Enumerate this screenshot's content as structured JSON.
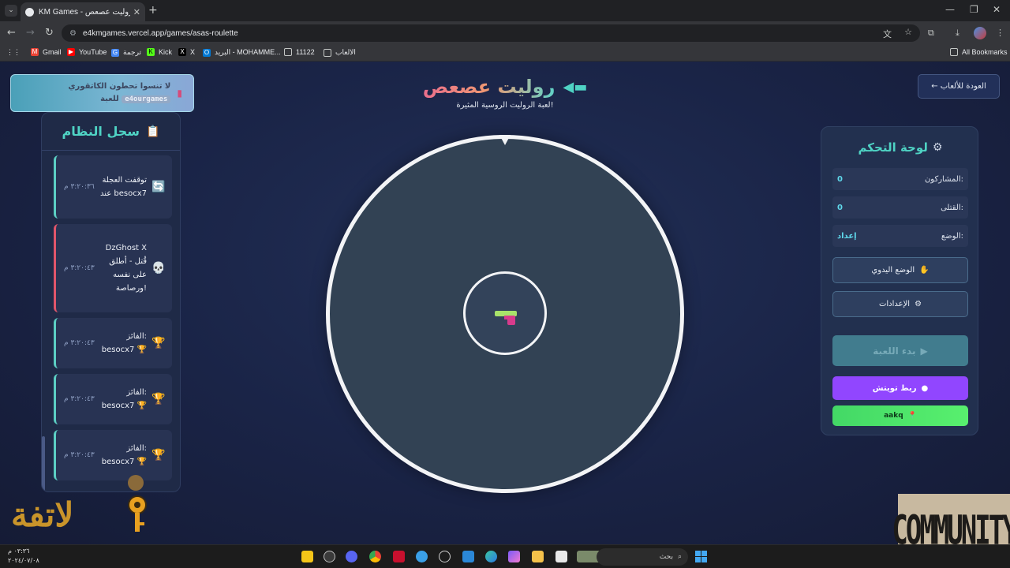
{
  "browser": {
    "tab_title": "KM Games - روليت عصعص 🔫",
    "url": "e4kmgames.vercel.app/games/asas-roulette",
    "bookmarks": [
      {
        "label": "Gmail",
        "color": "#ea4335"
      },
      {
        "label": "YouTube",
        "color": "#ff0000"
      },
      {
        "label": "ترجمة",
        "color": "#4285f4"
      },
      {
        "label": "Kick",
        "color": "#53fc18"
      },
      {
        "label": "X",
        "color": "#000000"
      },
      {
        "label": "البريد - MOHAMME...",
        "color": "#0078d4"
      },
      {
        "label": "11122",
        "color": ""
      },
      {
        "label": "الالعاب",
        "color": ""
      }
    ],
    "all_bookmarks": "All Bookmarks"
  },
  "banner": {
    "line1": "لا تنسوا تحطون الكاتقوري",
    "code": "e4ourgames",
    "line2_suffix": "للعبة"
  },
  "log": {
    "title": "سجل النظام",
    "entries": [
      {
        "message": "توقفت العجلة عند besocx7",
        "time": "٣:٢٠:٣٦ م",
        "icon": "🔄",
        "kind": "info"
      },
      {
        "message": "DzGhost X قُتل - أطلق على نفسه ورصاصة!",
        "time": "٣:٢٠:٤٣ م",
        "icon": "💀",
        "kind": "kill"
      },
      {
        "message": "الفائز: besocx7 🏆",
        "time": "٣:٢٠:٤٣ م",
        "icon": "🏆",
        "kind": "win"
      },
      {
        "message": "الفائز: besocx7 🏆",
        "time": "٣:٢٠:٤٣ م",
        "icon": "🏆",
        "kind": "win"
      },
      {
        "message": "الفائز: besocx7 🏆",
        "time": "٣:٢٠:٤٣ م",
        "icon": "🏆",
        "kind": "win"
      }
    ]
  },
  "header": {
    "title": "روليت عصعص",
    "subtitle": "لعبة الروليت الروسية المثيرة!",
    "back_label": "← العودة للألعاب"
  },
  "control": {
    "title": "لوحة التحكم",
    "participants_label": "المشاركون:",
    "participants": "0",
    "kills_label": "القتلى:",
    "kills": "0",
    "status_label": "الوضع:",
    "status": "إعداد",
    "manual_label": "الوضع اليدوي",
    "settings_label": "الإعدادات",
    "start_label": "بدء اللعبة",
    "twitch_label": "ربط تويتش",
    "kick_label": "aakq"
  },
  "watermarks": {
    "left": "لاتفة",
    "right": "COMMUNITY"
  },
  "taskbar": {
    "time": "٠٣:٣٦ م",
    "date": "٢٠٢٤/٠٧/٠٨",
    "search_placeholder": "بحث"
  },
  "colors": {
    "accent_teal": "#4fd3c4",
    "twitch": "#9146ff",
    "kick": "#53fc18",
    "log_kill": "#e0566b"
  }
}
